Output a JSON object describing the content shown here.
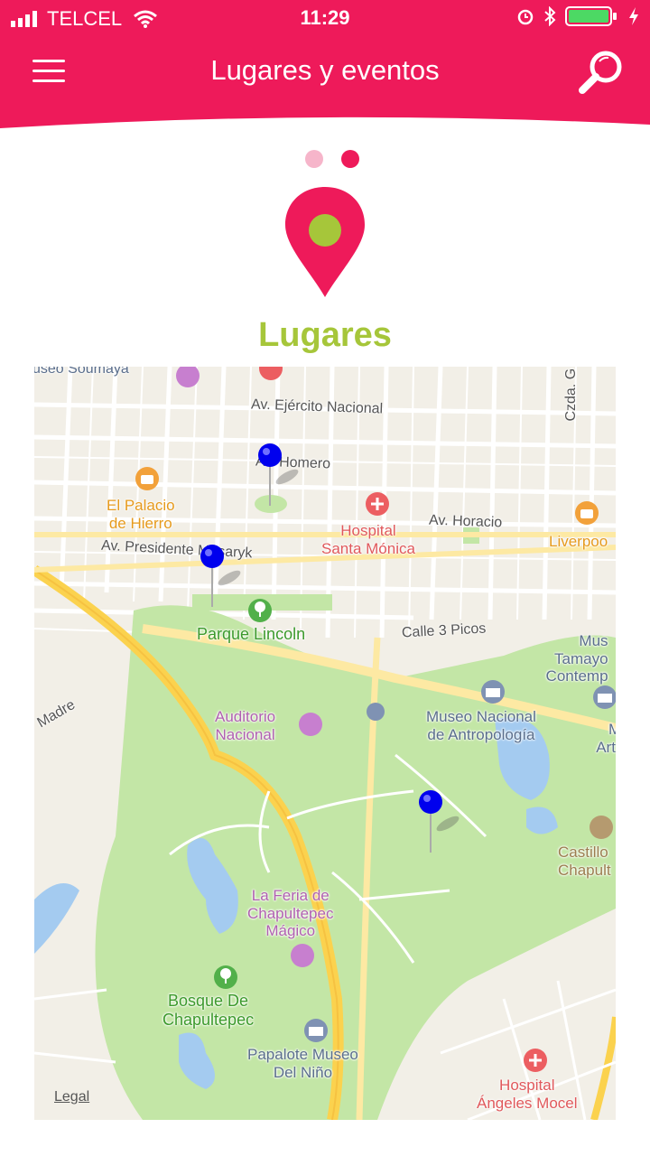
{
  "status_bar": {
    "carrier": "TELCEL",
    "time": "11:29"
  },
  "header": {
    "title": "Lugares y eventos",
    "menu_icon": "hamburger-menu-icon",
    "search_icon": "search-icon"
  },
  "pager": {
    "count": 2,
    "active": 1
  },
  "section": {
    "title": "Lugares",
    "icon": "location-pin-icon"
  },
  "colors": {
    "primary": "#ee1a5a",
    "accent": "#a6c63a"
  },
  "map": {
    "legal": "Legal",
    "streets": {
      "ejercito": "Av. Ejército Nacional",
      "homero": "Av. Homero",
      "horacio": "Av. Horacio",
      "masaryk": "Av. Presidente Masaryk",
      "picos": "Calle 3 Picos",
      "madre": "Madre",
      "czda": "Czda. G",
      "soumaya": "useo Soumaya"
    },
    "pois": {
      "palacio_1": "El Palacio",
      "palacio_2": "de Hierro",
      "hospital_sm_1": "Hospital",
      "hospital_sm_2": "Santa Mónica",
      "liverpool": "Liverpoo",
      "lincoln": "Parque Lincoln",
      "auditorio_1": "Auditorio",
      "auditorio_2": "Nacional",
      "antropologia_1": "Museo Nacional",
      "antropologia_2": "de Antropología",
      "tamayo_1": "Mus",
      "tamayo_2": "Tamayo",
      "tamayo_3": "Contemp",
      "arte_1": "M",
      "arte_2": "Art",
      "castillo_1": "Castillo",
      "castillo_2": "Chapult",
      "feria_1": "La Feria de",
      "feria_2": "Chapultepec",
      "feria_3": "Mágico",
      "bosque_1": "Bosque De",
      "bosque_2": "Chapultepec",
      "papalote_1": "Papalote Museo",
      "papalote_2": "Del Niño",
      "angeles_1": "Hospital",
      "angeles_2": "Ángeles Mocel"
    },
    "markers": [
      {
        "name": "map-marker-homero"
      },
      {
        "name": "map-marker-lincoln"
      },
      {
        "name": "map-marker-chapultepec"
      }
    ]
  }
}
